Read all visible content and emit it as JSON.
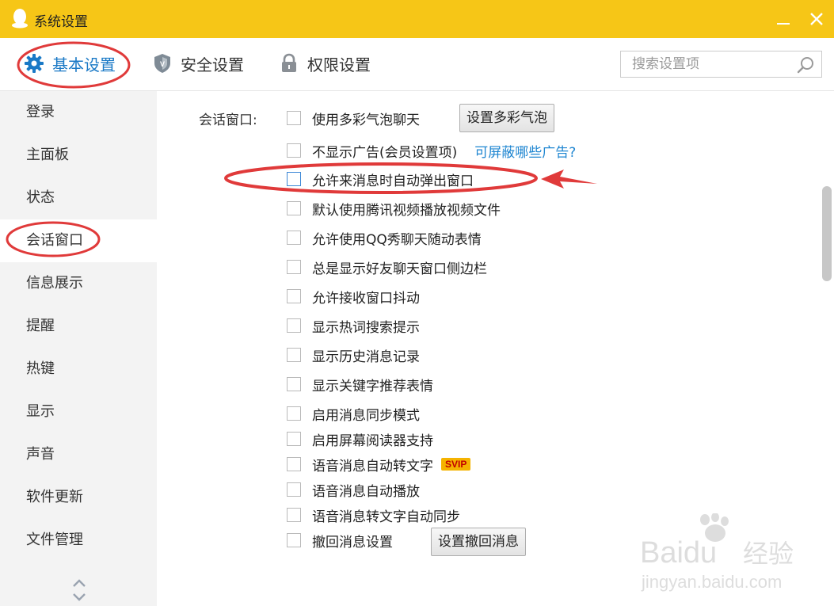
{
  "window": {
    "title": "系统设置"
  },
  "toolbar": {
    "tabs": [
      {
        "label": "基本设置",
        "active": true
      },
      {
        "label": "安全设置"
      },
      {
        "label": "权限设置"
      }
    ],
    "search_placeholder": "搜索设置项"
  },
  "sidebar": {
    "items": [
      {
        "label": "登录"
      },
      {
        "label": "主面板"
      },
      {
        "label": "状态"
      },
      {
        "label": "会话窗口",
        "active": true
      },
      {
        "label": "信息展示"
      },
      {
        "label": "提醒"
      },
      {
        "label": "热键"
      },
      {
        "label": "显示"
      },
      {
        "label": "声音"
      },
      {
        "label": "软件更新"
      },
      {
        "label": "文件管理"
      }
    ]
  },
  "content": {
    "section_label": "会话窗口:",
    "options": [
      {
        "label": "使用多彩气泡聊天",
        "checked": false,
        "button": "设置多彩气泡"
      },
      {
        "label": "不显示广告(会员设置项)",
        "checked": false,
        "link": "可屏蔽哪些广告?"
      },
      {
        "label": "允许来消息时自动弹出窗口",
        "checked": false,
        "highlighted": true
      },
      {
        "label": "默认使用腾讯视频播放视频文件",
        "checked": false
      },
      {
        "label": "允许使用QQ秀聊天随动表情",
        "checked": false
      },
      {
        "label": "总是显示好友聊天窗口侧边栏",
        "checked": false
      },
      {
        "label": "允许接收窗口抖动",
        "checked": false
      },
      {
        "label": "显示热词搜索提示",
        "checked": false
      },
      {
        "label": "显示历史消息记录",
        "checked": false
      },
      {
        "label": "显示关键字推荐表情",
        "checked": false
      },
      {
        "label": "启用消息同步模式",
        "checked": false
      },
      {
        "label": "启用屏幕阅读器支持",
        "checked": false
      },
      {
        "label": "语音消息自动转文字",
        "checked": false,
        "badge": "SVIP"
      },
      {
        "label": "语音消息自动播放",
        "checked": false
      },
      {
        "label": "语音消息转文字自动同步",
        "checked": false
      },
      {
        "label": "撤回消息设置",
        "checked": false,
        "button": "设置撤回消息"
      }
    ]
  },
  "watermark": {
    "brand": "Baidu",
    "brand_cn": "经验",
    "url": "jingyan.baidu.com"
  },
  "colors": {
    "titlebar": "#f6c617",
    "accent": "#1a79c6",
    "annotation": "#e03a3a"
  }
}
